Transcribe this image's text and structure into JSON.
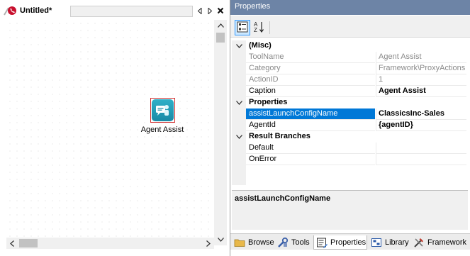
{
  "document": {
    "tab_title": "Untitled*",
    "node_caption": "Agent Assist"
  },
  "properties": {
    "panel_title": "Properties",
    "categories": [
      {
        "name": "(Misc)",
        "rows": [
          {
            "name": "ToolName",
            "value": "Agent Assist",
            "readonly": true
          },
          {
            "name": "Category",
            "value": "Framework\\ProxyActions",
            "readonly": true
          },
          {
            "name": "ActionID",
            "value": "1",
            "readonly": true
          },
          {
            "name": "Caption",
            "value": "Agent Assist",
            "readonly": false
          }
        ]
      },
      {
        "name": "Properties",
        "rows": [
          {
            "name": "assistLaunchConfigName",
            "value": "ClassicsInc-Sales",
            "readonly": false,
            "selected": true
          },
          {
            "name": "AgentId",
            "value": "{agentID}",
            "readonly": false
          }
        ]
      },
      {
        "name": "Result Branches",
        "rows": [
          {
            "name": "Default",
            "value": "",
            "readonly": false
          },
          {
            "name": "OnError",
            "value": "",
            "readonly": false
          }
        ]
      }
    ],
    "description_title": "assistLaunchConfigName"
  },
  "bottom_tabs": [
    {
      "label": "Browse",
      "icon": "folder-icon",
      "active": false
    },
    {
      "label": "Tools",
      "icon": "tools-icon",
      "active": false
    },
    {
      "label": "Properties",
      "icon": "properties-icon",
      "active": true
    },
    {
      "label": "Library",
      "icon": "library-icon",
      "active": false
    },
    {
      "label": "Framework",
      "icon": "framework-icon",
      "active": false
    }
  ],
  "colors": {
    "panel_title_bg": "#6d84a6",
    "selection": "#0078d7",
    "node_icon": "#1f9bb8",
    "node_border": "#d03030"
  }
}
